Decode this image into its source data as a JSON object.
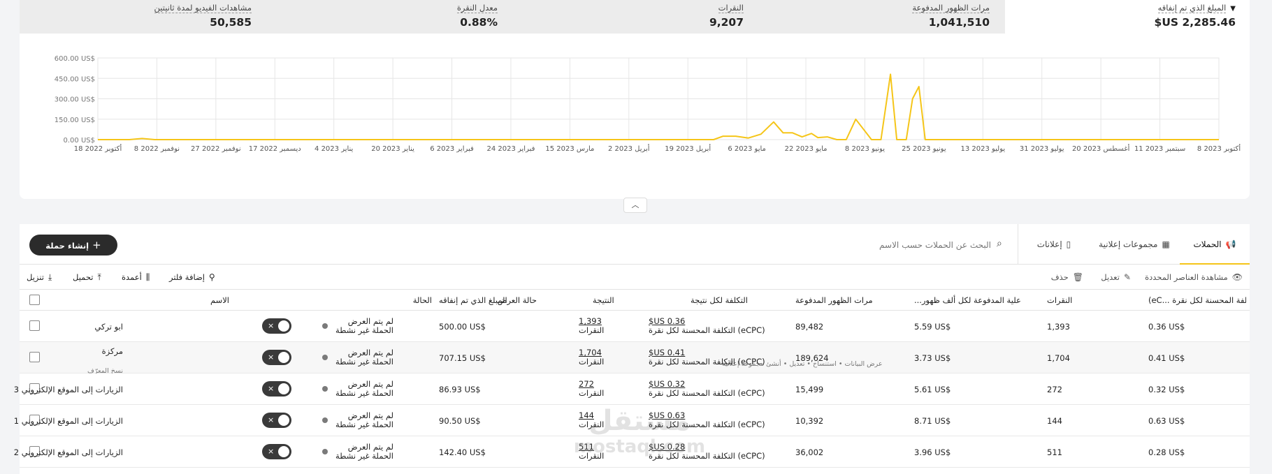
{
  "metrics": [
    {
      "label": "المبلغ الذي تم إنفاقه",
      "value": "2,285.46 US$",
      "has_dropdown": true
    },
    {
      "label": "مرات الظهور المدفوعة",
      "value": "1,041,510"
    },
    {
      "label": "النقرات",
      "value": "9,207"
    },
    {
      "label": "معدل النقرة",
      "value": "0.88%"
    },
    {
      "label": "مشاهدات الفيديو لمدة ثانيتين",
      "value": "50,585"
    }
  ],
  "chart_data": {
    "type": "line",
    "ylabel": "",
    "ylim": [
      0,
      600
    ],
    "y_ticks": [
      "0.00 US$",
      "150.00 US$",
      "300.00 US$",
      "450.00 US$",
      "600.00 US$"
    ],
    "x_ticks": [
      "18 أكتوبر 2022",
      "8 نوفمبر 2022",
      "27 نوفمبر 2022",
      "17 ديسمبر 2022",
      "4 يناير 2023",
      "20 يناير 2023",
      "6 فبراير 2023",
      "24 فبراير 2023",
      "15 مارس 2023",
      "2 أبريل 2023",
      "19 أبريل 2023",
      "6 مايو 2023",
      "22 مايو 2023",
      "8 يونيو 2023",
      "25 يونيو 2023",
      "13 يوليو 2023",
      "31 يوليو 2023",
      "20 أغسطس 2023",
      "11 سبتمبر 2023",
      "8 أكتوبر 2023"
    ],
    "grid": true,
    "color": "#f5c518",
    "series": [
      {
        "x": [
          "2022-10-18",
          "2022-10-28",
          "2022-11-01",
          "2022-11-05",
          "2023-05-01",
          "2023-05-04",
          "2023-05-08",
          "2023-05-12",
          "2023-05-16",
          "2023-05-20",
          "2023-05-23",
          "2023-05-26",
          "2023-05-29",
          "2023-06-01",
          "2023-06-03",
          "2023-06-06",
          "2023-06-09",
          "2023-06-12",
          "2023-06-15",
          "2023-06-20",
          "2023-06-23",
          "2023-06-26",
          "2023-06-28",
          "2023-07-01",
          "2023-07-03",
          "2023-07-05",
          "2023-07-07",
          "2023-07-09",
          "2023-07-11",
          "2023-07-13",
          "2023-10-08"
        ],
        "values": [
          0,
          0,
          8,
          0,
          0,
          25,
          25,
          12,
          40,
          130,
          50,
          50,
          20,
          45,
          15,
          20,
          0,
          0,
          150,
          0,
          0,
          480,
          0,
          0,
          300,
          390,
          0,
          0,
          0,
          0,
          0
        ]
      }
    ]
  },
  "collapse_icon": "chevron-up-icon",
  "tabs": [
    {
      "label": "الحملات",
      "icon": "megaphone-icon",
      "active": true
    },
    {
      "label": "مجموعات إعلانية",
      "icon": "grid-icon",
      "active": false
    },
    {
      "label": "إعلانات",
      "icon": "phone-icon",
      "active": false
    }
  ],
  "search": {
    "placeholder": "البحث عن الحملات حسب الاسم"
  },
  "create_button": "إنشاء حملة",
  "toolbar": {
    "view_selected": "مشاهدة العناصر المحددة",
    "edit": "تعديل",
    "delete": "حذف",
    "add_filter": "إضافة فلتر",
    "columns": "أعمدة",
    "upload": "تحميل",
    "download": "تنزيل"
  },
  "columns": {
    "name": "الاسم",
    "status": "الحالة",
    "delivery": "حالة العرض",
    "spent": "المبلغ الذي تم إنفاقه",
    "result": "النتيجة",
    "cost_per_result": "التكلفة لكل نتيجة",
    "paid_impressions": "مرات الظهور المدفوعة",
    "cpm": "...علية المدفوعة لكل ألف ظهور",
    "clicks": "النقرات",
    "ecpc": "(eC... التكلفة المحسنة لكل نقرة"
  },
  "rows": [
    {
      "name": "ابو تركي",
      "delivery_1": "لم يتم العرض",
      "delivery_2": "الحملة غير نشطة",
      "spent": "500.00 US$",
      "result": "1,393",
      "result_unit": "النقرات",
      "cost": "0.36 US$",
      "cost_unit": "(eCPC) التكلفة المحسنة لكل نقرة",
      "impressions": "89,482",
      "cpm": "5.59 US$",
      "clicks": "1,393",
      "ecpc": "0.36 US$"
    },
    {
      "name": "مركزة",
      "actions": "عرض البيانات  •  استنساخ  •  تعديل  •  أنشئ مجموعة إعلانية",
      "actions_2": "نسخ المعرّف",
      "delivery_1": "لم يتم العرض",
      "delivery_2": "الحملة غير نشطة",
      "spent": "707.15 US$",
      "result": "1,704",
      "result_unit": "النقرات",
      "cost": "0.41 US$",
      "cost_unit": "(eCPC) التكلفة المحسنة لكل نقرة",
      "impressions": "189,624",
      "cpm": "3.73 US$",
      "clicks": "1,704",
      "ecpc": "0.41 US$"
    },
    {
      "name": "الزيارات إلى الموقع الإلكتروني 3",
      "delivery_1": "لم يتم العرض",
      "delivery_2": "الحملة غير نشطة",
      "spent": "86.93 US$",
      "result": "272",
      "result_unit": "النقرات",
      "cost": "0.32 US$",
      "cost_unit": "(eCPC) التكلفة المحسنة لكل نقرة",
      "impressions": "15,499",
      "cpm": "5.61 US$",
      "clicks": "272",
      "ecpc": "0.32 US$"
    },
    {
      "name": "الزيارات إلى الموقع الإلكتروني 1",
      "delivery_1": "لم يتم العرض",
      "delivery_2": "الحملة غير نشطة",
      "spent": "90.50 US$",
      "result": "144",
      "result_unit": "النقرات",
      "cost": "0.63 US$",
      "cost_unit": "(eCPC) التكلفة المحسنة لكل نقرة",
      "impressions": "10,392",
      "cpm": "8.71 US$",
      "clicks": "144",
      "ecpc": "0.63 US$"
    },
    {
      "name": "الزيارات إلى الموقع الإلكتروني 2",
      "delivery_1": "لم يتم العرض",
      "delivery_2": "الحملة غير نشطة",
      "spent": "142.40 US$",
      "result": "511",
      "result_unit": "النقرات",
      "cost": "0.28 US$",
      "cost_unit": "(eCPC) التكلفة المحسنة لكل نقرة",
      "impressions": "36,002",
      "cpm": "3.96 US$",
      "clicks": "511",
      "ecpc": "0.28 US$"
    }
  ],
  "watermark": {
    "line1": "مستقل",
    "line2": "mostaql.com"
  }
}
